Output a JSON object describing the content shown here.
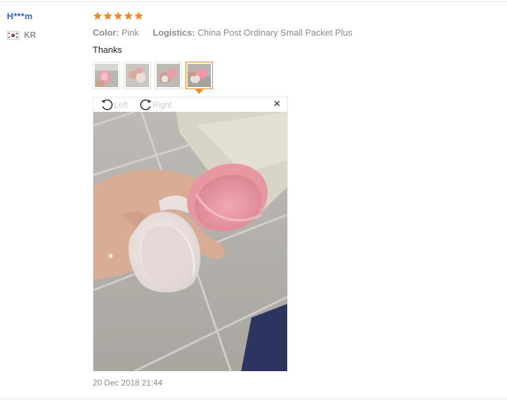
{
  "reviewer": {
    "name": "H***m",
    "country_code": "KR",
    "flag_icon": "korea-flag-icon"
  },
  "rating": {
    "stars": 5,
    "max": 5,
    "color": "#f08a24"
  },
  "attributes": {
    "color_key": "Color:",
    "color_value": "Pink",
    "logistics_key": "Logistics:",
    "logistics_value": "China Post Ordinary Small Packet Plus"
  },
  "feedback": "Thanks",
  "thumbnails": {
    "count": 4,
    "active_index": 3
  },
  "viewer": {
    "rotate_left_label": "Left",
    "rotate_right_label": "Right",
    "close_glyph": "×"
  },
  "date": "20 Dec 2018 21:44"
}
